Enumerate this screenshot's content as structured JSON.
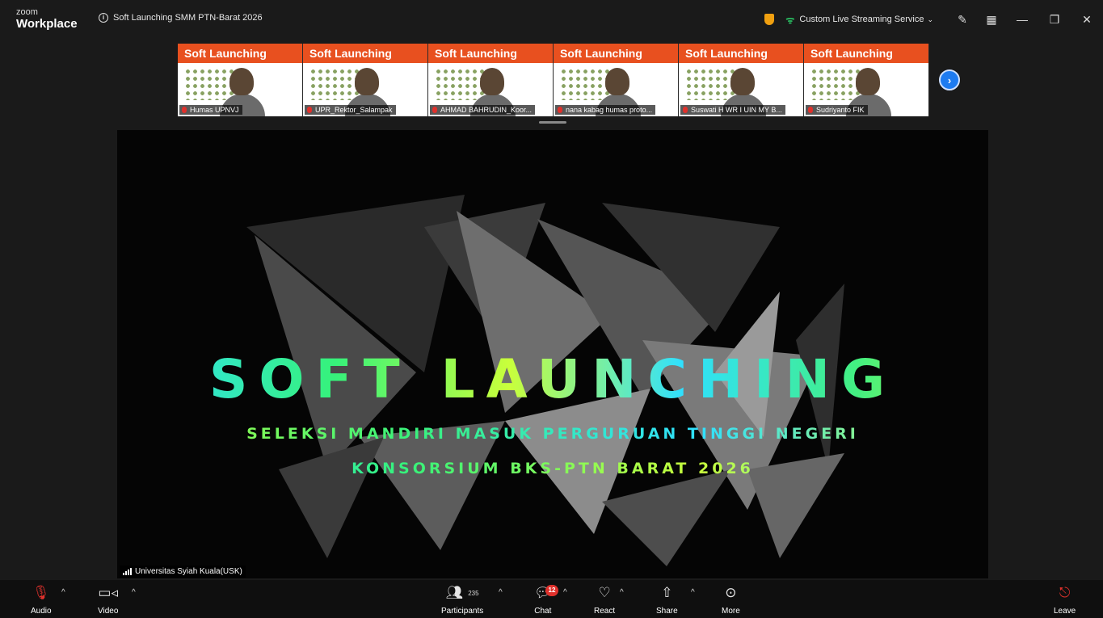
{
  "app": {
    "logo_top": "zoom",
    "logo_bottom": "Workplace"
  },
  "meeting": {
    "title": "Soft Launching SMM PTN-Barat 2026"
  },
  "titlebar": {
    "streaming_label": "Custom Live Streaming Service"
  },
  "thumbnails": [
    {
      "banner": "Soft Launching",
      "name": "Humas UPNVJ",
      "banner_color": "#e8501f"
    },
    {
      "banner": "Soft Launching",
      "name": "UPR_Rektor_Salampak",
      "banner_color": "#e8501f"
    },
    {
      "banner": "Soft Launching",
      "name": "AHMAD BAHRUDIN_Koor...",
      "banner_color": "#e8501f"
    },
    {
      "banner": "Soft Launching",
      "name": "nana kabag humas proto...",
      "banner_color": "#e8501f"
    },
    {
      "banner": "Soft Launching",
      "name": "Suswati H WR I UIN MY B...",
      "banner_color": "#e8501f"
    },
    {
      "banner": "Soft Launching",
      "name": "Sudriyanto FIK",
      "banner_color": "#e8501f"
    }
  ],
  "share": {
    "headline": "SOFT LAUNCHING",
    "line1": "SELEKSI MANDIRI MASUK PERGURUAN TINGGI NEGERI",
    "line2": "KONSORSIUM BKS-PTN BARAT 2026",
    "sharer": "Universitas Syiah Kuala(USK)"
  },
  "toolbar": {
    "audio": "Audio",
    "video": "Video",
    "participants": "Participants",
    "participant_count": "235",
    "chat": "Chat",
    "chat_badge": "12",
    "react": "React",
    "share": "Share",
    "more": "More",
    "leave": "Leave"
  },
  "colors": {
    "accent": "#1e7bf0",
    "danger": "#e0312c",
    "shield": "#f0a010",
    "streaming": "#2bd36a"
  }
}
